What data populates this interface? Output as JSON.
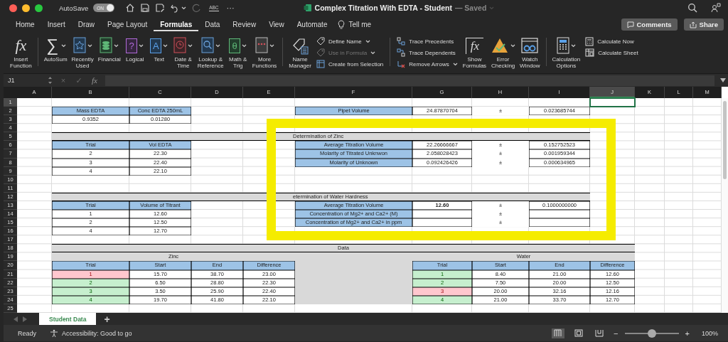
{
  "title_bar": {
    "autosave": {
      "label": "AutoSave",
      "on": true,
      "state_text": "ON"
    },
    "spelling": "ABC",
    "more": "···",
    "title": "Complex Titration With EDTA - Student",
    "save_status": "— Saved"
  },
  "tabs": [
    {
      "label": "Home",
      "selected": false
    },
    {
      "label": "Insert",
      "selected": false
    },
    {
      "label": "Draw",
      "selected": false
    },
    {
      "label": "Page Layout",
      "selected": false
    },
    {
      "label": "Formulas",
      "selected": true
    },
    {
      "label": "Data",
      "selected": false
    },
    {
      "label": "Review",
      "selected": false
    },
    {
      "label": "View",
      "selected": false
    },
    {
      "label": "Automate",
      "selected": false
    }
  ],
  "tell_me": "Tell me",
  "comments": "Comments",
  "share": "Share",
  "ribbon": {
    "groups": [
      {
        "items": [
          {
            "kind": "big",
            "label": "Insert\nFunction",
            "symbol": "fx",
            "dropdown": false
          }
        ]
      },
      {
        "items": [
          {
            "kind": "big",
            "label": "AutoSum",
            "symbol": "∑",
            "dropdown": true
          },
          {
            "kind": "big",
            "label": "Recently\nUsed",
            "dropdown": true
          },
          {
            "kind": "big",
            "label": "Financial",
            "dropdown": true
          },
          {
            "kind": "big",
            "label": "Logical",
            "symbol": "?",
            "dropdown": true
          },
          {
            "kind": "big",
            "label": "Text",
            "symbol": "A",
            "dropdown": true
          },
          {
            "kind": "big",
            "label": "Date &\nTime",
            "dropdown": true
          },
          {
            "kind": "big",
            "label": "Lookup &\nReference",
            "dropdown": true
          },
          {
            "kind": "big",
            "label": "Math &\nTrig",
            "symbol": "θ",
            "dropdown": true
          },
          {
            "kind": "big",
            "label": "More\nFunctions",
            "dropdown": true
          }
        ]
      },
      {
        "items": [
          {
            "kind": "big",
            "label": "Name\nManager",
            "dropdown": false
          },
          {
            "kind": "stack",
            "items": [
              {
                "label": "Define Name",
                "dropdown": true,
                "disabled": false
              },
              {
                "label": "Use in Formula",
                "dropdown": true,
                "disabled": true
              },
              {
                "label": "Create from Selection",
                "dropdown": false,
                "disabled": false
              }
            ]
          }
        ]
      },
      {
        "items": [
          {
            "kind": "stack",
            "items": [
              {
                "label": "Trace Precedents",
                "dropdown": false,
                "disabled": false
              },
              {
                "label": "Trace Dependents",
                "dropdown": false,
                "disabled": false
              },
              {
                "label": "Remove Arrows",
                "dropdown": true,
                "disabled": false
              }
            ]
          },
          {
            "kind": "big",
            "label": "Show\nFormulas",
            "symbol": "fx",
            "dropdown": false
          },
          {
            "kind": "big",
            "label": "Error\nChecking",
            "dropdown": true
          },
          {
            "kind": "big",
            "label": "Watch\nWindow",
            "dropdown": false
          }
        ]
      },
      {
        "items": [
          {
            "kind": "big",
            "label": "Calculation\nOptions",
            "dropdown": true
          },
          {
            "kind": "stack",
            "items": [
              {
                "label": "Calculate Now",
                "dropdown": false,
                "disabled": false
              },
              {
                "label": "Calculate Sheet",
                "dropdown": false,
                "disabled": false
              }
            ]
          }
        ]
      }
    ]
  },
  "formula_bar": {
    "name_box": "J1",
    "cancel": "×",
    "enter": "✓",
    "fx": "fx"
  },
  "columns": [
    {
      "letter": "A",
      "selected": false
    },
    {
      "letter": "B",
      "selected": false
    },
    {
      "letter": "C",
      "selected": false
    },
    {
      "letter": "D",
      "selected": false
    },
    {
      "letter": "E",
      "selected": false
    },
    {
      "letter": "F",
      "selected": false
    },
    {
      "letter": "G",
      "selected": false
    },
    {
      "letter": "H",
      "selected": false
    },
    {
      "letter": "I",
      "selected": false
    },
    {
      "letter": "J",
      "selected": true
    },
    {
      "letter": "K",
      "selected": false
    },
    {
      "letter": "L",
      "selected": false
    },
    {
      "letter": "M",
      "selected": false
    }
  ],
  "rows": [
    {
      "number": "1",
      "selected": true
    },
    {
      "number": "2",
      "selected": false
    },
    {
      "number": "3",
      "selected": false
    },
    {
      "number": "4",
      "selected": false
    },
    {
      "number": "5",
      "selected": false
    },
    {
      "number": "6",
      "selected": false
    },
    {
      "number": "7",
      "selected": false
    },
    {
      "number": "8",
      "selected": false
    },
    {
      "number": "9",
      "selected": false
    },
    {
      "number": "10",
      "selected": false
    },
    {
      "number": "11",
      "selected": false
    },
    {
      "number": "12",
      "selected": false
    },
    {
      "number": "13",
      "selected": false
    },
    {
      "number": "14",
      "selected": false
    },
    {
      "number": "15",
      "selected": false
    },
    {
      "number": "16",
      "selected": false
    },
    {
      "number": "17",
      "selected": false
    },
    {
      "number": "18",
      "selected": false
    },
    {
      "number": "19",
      "selected": false
    },
    {
      "number": "20",
      "selected": false
    },
    {
      "number": "21",
      "selected": false
    },
    {
      "number": "22",
      "selected": false
    },
    {
      "number": "23",
      "selected": false
    },
    {
      "number": "24",
      "selected": false
    },
    {
      "number": "25",
      "selected": false
    }
  ],
  "inputs": {
    "headers": [
      "Mass EDTA",
      "Conc EDTA 250mL"
    ],
    "values": [
      "0.9352",
      "0.01280"
    ]
  },
  "pipet": {
    "label": "Pipet Volume",
    "value": "24.87870704",
    "sign": "±",
    "uncertainty": "0.023685744"
  },
  "zinc_volumes": {
    "headers": [
      "Trial",
      "Vol EDTA"
    ],
    "rows": [
      [
        "2",
        "22.30"
      ],
      [
        "3",
        "22.40"
      ],
      [
        "4",
        "22.10"
      ]
    ]
  },
  "zinc_results": {
    "title": "Determination of Zinc",
    "rows": [
      {
        "label": "Average Titration Volume",
        "value": "22.26666667",
        "sign": "±",
        "uncertainty": "0.152752523",
        "bold": false
      },
      {
        "label": "Molarity of Titrated Unknwon",
        "value": "2.058028423",
        "sign": "±",
        "uncertainty": "0.001959344",
        "bold": false
      },
      {
        "label": "Molarity of Unknown",
        "value": "0.092426426",
        "sign": "±",
        "uncertainty": "0.000634965",
        "bold": false
      }
    ]
  },
  "titrant_volumes": {
    "headers": [
      "Trial",
      "Volume of Titrant"
    ],
    "rows": [
      [
        "1",
        "12.60"
      ],
      [
        "2",
        "12.50"
      ],
      [
        "4",
        "12.70"
      ]
    ]
  },
  "water_results": {
    "title": "etermination of Water Hardness",
    "rows": [
      {
        "label": "Average Titration Volume",
        "value": "12.60",
        "sign": "±",
        "uncertainty": "0.1000000000",
        "bold": true
      },
      {
        "label": "Concentration of Mg2+ and Ca2+ (M)",
        "sign": "±"
      },
      {
        "label": "Concentration of Mg2+ and Ca2+ in ppm",
        "sign": "±"
      }
    ]
  },
  "data": {
    "title": "Data",
    "tables": [
      {
        "title": "Zinc",
        "headers": [
          "Trial",
          "Start",
          "End",
          "Difference"
        ],
        "rows": [
          {
            "cells": [
              "1",
              "15.70",
              "38.70",
              "23.00"
            ],
            "rejected": true
          },
          {
            "cells": [
              "2",
              "6.50",
              "28.80",
              "22.30"
            ],
            "rejected": false
          },
          {
            "cells": [
              "3",
              "3.50",
              "25.90",
              "22.40"
            ],
            "rejected": false
          },
          {
            "cells": [
              "4",
              "19.70",
              "41.80",
              "22.10"
            ],
            "rejected": false
          }
        ]
      },
      {
        "title": "Water",
        "headers": [
          "Trial",
          "Start",
          "End",
          "Difference"
        ],
        "rows": [
          {
            "cells": [
              "1",
              "8.40",
              "21.00",
              "12.60"
            ],
            "rejected": false
          },
          {
            "cells": [
              "2",
              "7.50",
              "20.00",
              "12.50"
            ],
            "rejected": false
          },
          {
            "cells": [
              "3",
              "20.00",
              "32.16",
              "12.16"
            ],
            "rejected": true
          },
          {
            "cells": [
              "4",
              "21.00",
              "33.70",
              "12.70"
            ],
            "rejected": false
          }
        ]
      }
    ]
  },
  "sheets": [
    {
      "label": "Student Data",
      "selected": true
    }
  ],
  "add_sheet": "+",
  "status_bar": {
    "ready": "Ready",
    "accessibility": "Accessibility: Good to go",
    "views": [
      {
        "selected": true
      },
      {
        "selected": false
      },
      {
        "selected": false
      }
    ],
    "zoom": {
      "minus": "−",
      "plus": "+",
      "level": 0.5,
      "percent": "100%"
    }
  }
}
